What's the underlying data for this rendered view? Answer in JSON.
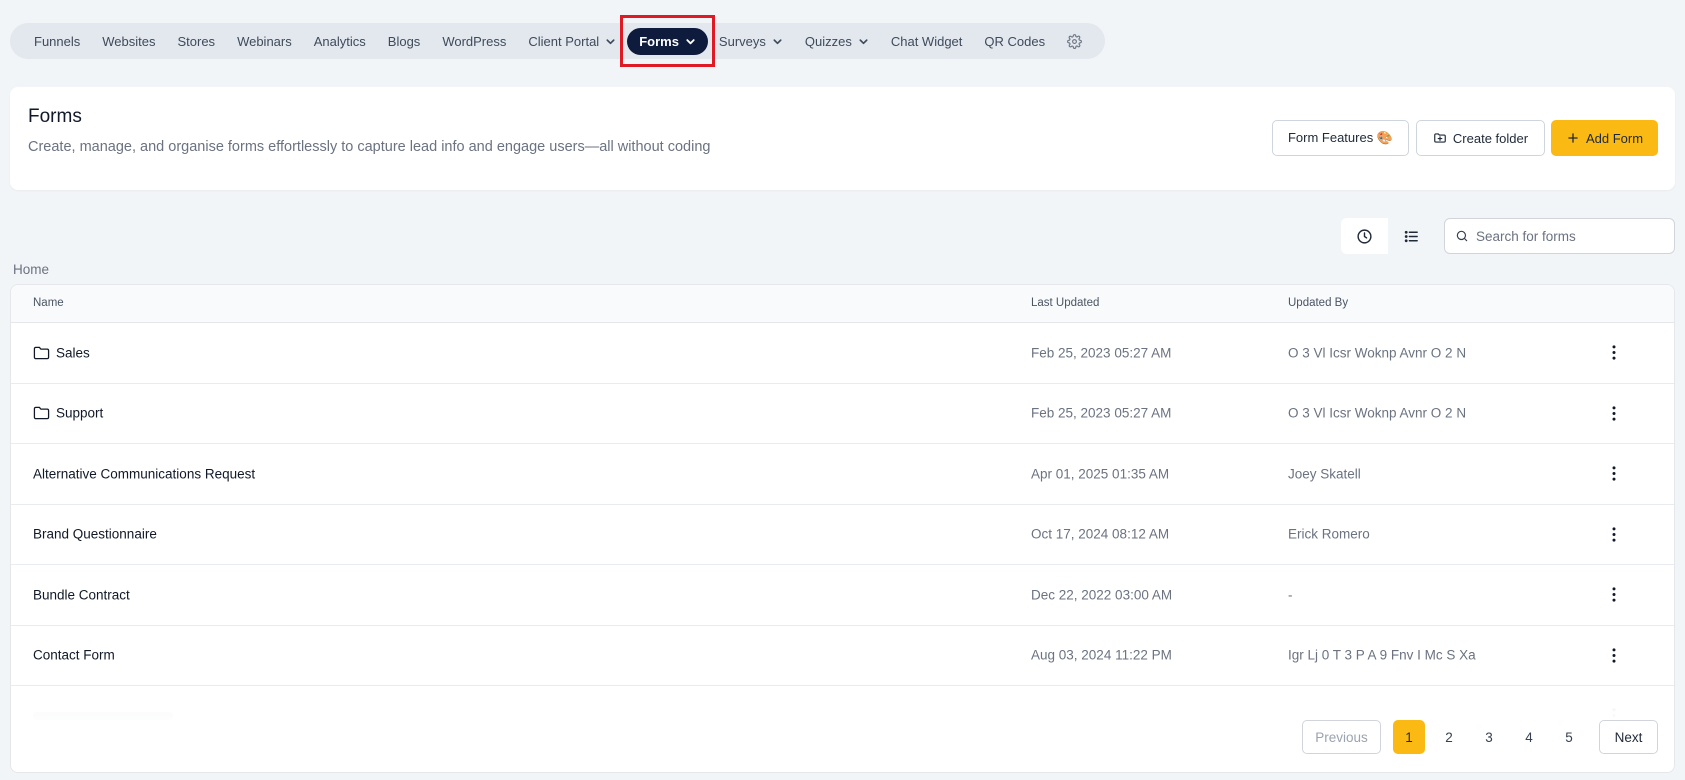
{
  "nav": {
    "items": [
      {
        "label": "Funnels"
      },
      {
        "label": "Websites"
      },
      {
        "label": "Stores"
      },
      {
        "label": "Webinars"
      },
      {
        "label": "Analytics"
      },
      {
        "label": "Blogs"
      },
      {
        "label": "WordPress"
      },
      {
        "label": "Client Portal"
      },
      {
        "label": "Forms"
      },
      {
        "label": "Surveys"
      },
      {
        "label": "Quizzes"
      },
      {
        "label": "Chat Widget"
      },
      {
        "label": "QR Codes"
      }
    ],
    "active": "Forms"
  },
  "header": {
    "title": "Forms",
    "description": "Create, manage, and organise forms effortlessly to capture lead info and engage users—all without coding",
    "buttons": {
      "features": "Form Features 🎨",
      "create_folder": "Create folder",
      "add_form": "Add Form"
    }
  },
  "search": {
    "placeholder": "Search for forms"
  },
  "breadcrumb": "Home",
  "table": {
    "headers": {
      "name": "Name",
      "last_updated": "Last Updated",
      "updated_by": "Updated By"
    },
    "rows": [
      {
        "name": "Sales",
        "type": "folder",
        "last_updated": "Feb 25, 2023 05:27 AM",
        "updated_by": "O 3 Vl Icsr Woknp Avnr O 2 N"
      },
      {
        "name": "Support",
        "type": "folder",
        "last_updated": "Feb 25, 2023 05:27 AM",
        "updated_by": "O 3 Vl Icsr Woknp Avnr O 2 N"
      },
      {
        "name": "Alternative Communications Request",
        "type": "form",
        "last_updated": "Apr 01, 2025 01:35 AM",
        "updated_by": "Joey Skatell"
      },
      {
        "name": "Brand Questionnaire",
        "type": "form",
        "last_updated": "Oct 17, 2024 08:12 AM",
        "updated_by": "Erick Romero"
      },
      {
        "name": "Bundle Contract",
        "type": "form",
        "last_updated": "Dec 22, 2022 03:00 AM",
        "updated_by": "-"
      },
      {
        "name": "Contact Form",
        "type": "form",
        "last_updated": "Aug 03, 2024 11:22 PM",
        "updated_by": "Igr Lj 0 T 3 P A 9 Fnv I Mc S Xa"
      }
    ]
  },
  "pagination": {
    "previous": "Previous",
    "pages": [
      "1",
      "2",
      "3",
      "4",
      "5"
    ],
    "current": "1",
    "next": "Next"
  },
  "colors": {
    "accent": "#fbb913",
    "nav_active": "#0e1b3d",
    "highlight": "#e01a24"
  }
}
